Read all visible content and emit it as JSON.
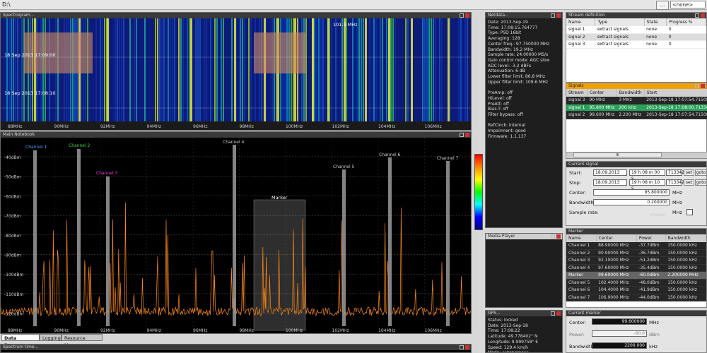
{
  "path": {
    "text": "D:\\",
    "dots": "...",
    "select": "<none>"
  },
  "spectrogram": {
    "title": "Spectrogram...",
    "time_labels": [
      "18 Sep 2013 17:09:00",
      "18 Sep 2013 17:08:10"
    ],
    "freq_badge": "101.9 MHz",
    "x_ticks": [
      "88MHz",
      "90MHz",
      "92MHz",
      "94MHz",
      "96MHz",
      "98MHz",
      "100MHz",
      "102MHz",
      "104MHz",
      "106MHz",
      "108"
    ]
  },
  "main": {
    "title": "Main Notebook",
    "y_ticks": [
      "-40dBm",
      "-50dBm",
      "-60dBm",
      "-70dBm",
      "-80dBm",
      "-90dBm",
      "-100dBm",
      "-110dBm",
      "-120dBm"
    ],
    "x_ticks": [
      "88MHz",
      "90MHz",
      "92MHz",
      "94MHz",
      "96MHz",
      "98MHz",
      "100MHz",
      "102MHz",
      "104MHz",
      "106MHz",
      "108"
    ],
    "marker_label": "Marker",
    "channels": [
      {
        "name": "Channel 1",
        "color": "#4aa0ff"
      },
      {
        "name": "Channel 2",
        "color": "#3fd14a"
      },
      {
        "name": "Channel 3",
        "color": "#e040e0"
      },
      {
        "name": "Channel 4",
        "color": "#cccccc"
      },
      {
        "name": "Channel 5",
        "color": "#cccccc"
      },
      {
        "name": "Channel 6",
        "color": "#cccccc"
      },
      {
        "name": "Channel 7",
        "color": "#cccccc"
      }
    ],
    "trace_color": "#ff8a1a"
  },
  "tabs": [
    "Data Processor",
    "Logging",
    "Resource Manager"
  ],
  "spectrum_time": {
    "title": "Spectrum time..."
  },
  "netdata": {
    "title": "Netdata...",
    "lines": [
      "Date: 2013-Sep-19",
      "Time: 17:08:15.764777",
      "Type: PSD 16bit",
      "Averaging: 128",
      "Center freq.: 97.750000 MHz",
      "Bandwidth: 19.2 MHz",
      "Sample rate: 24.00000 MS/s",
      "Gain control mode: AGC slow",
      "ADC level: -3.2 dBFs",
      "Attenuation: 6 dB",
      "Lower filter limit: 86.8 MHz",
      "Upper filter limit: 109.6 MHz",
      "",
      "PreAmp: off",
      "HiLevel: off",
      "PreAtt: off",
      "Bias-T: off",
      "Filter bypass: off",
      "",
      "RefClock: internal",
      "Impairment: good",
      "Firmware: 1.1.137"
    ]
  },
  "media_player": {
    "title": "Media Player"
  },
  "gps": {
    "title": "GPS...",
    "lines": [
      "Status: locked",
      "Date: 2013-Sep-18",
      "Time: 17:08:22",
      "Latitude: 49.778402° N",
      "Longitude: 9.999758° E",
      "Speed: 129.4 km/h",
      "Mode: autonomous"
    ]
  },
  "stream_definition": {
    "title": "Stream definition",
    "headers": [
      "Name",
      "Type",
      "State",
      "Progress %"
    ],
    "rows": [
      [
        "signal 1",
        "extract signals",
        "none",
        "0"
      ],
      [
        "signal 2",
        "extract signals",
        "none",
        "0"
      ],
      [
        "signal 3",
        "extract signals",
        "none",
        "0"
      ]
    ]
  },
  "signals": {
    "title": "Signals",
    "headers": [
      "Stream",
      "Center",
      "Bandwidth",
      "Start"
    ],
    "rows": [
      [
        "signal 3",
        "90 MHz",
        "3 MHz",
        "2013-Sep-18 17:07:54.715006"
      ],
      [
        "signal 1",
        "95.800 MHz",
        "200 kHz",
        "2013-Sep-18 17:08:00.713342"
      ],
      [
        "signal 2",
        "99.600 MHz",
        "2.200 MHz",
        "2013-Sep-18 17:07:54.715006"
      ]
    ],
    "selected_row": 1,
    "scroll_label": "III"
  },
  "current_signal": {
    "title": "Current signal",
    "start_label": "Start:",
    "start_date": "18.09.2013",
    "start_time": "19 h  08 m  00 s",
    "start_ms": "713342",
    "stop_label": "Stop:",
    "stop_date": "18.09.2013",
    "stop_time": "19 h  08 m  10 s",
    "stop_ms": "713342",
    "set_label": "set",
    "goto_label": "goto",
    "center_label": "Center:",
    "center_value": "95.800000",
    "center_unit": "MHz",
    "bandwidth_label": "Bandwidth:",
    "bandwidth_value": "0.200000",
    "bandwidth_unit": "MHz",
    "sample_rate_label": "Sample rate:",
    "sample_rate_value": "_._____",
    "sample_rate_unit": "MHz"
  },
  "marker": {
    "title": "Marker",
    "headers": [
      "Name",
      "Center",
      "Power",
      "Bandwidth"
    ],
    "rows": [
      [
        "Channel 1",
        "88.90000 MHz",
        "-37.7dBm",
        "150.0000 kHz"
      ],
      [
        "Channel 2",
        "90.90000 MHz",
        "-36.7dBm",
        "150.0000 kHz"
      ],
      [
        "Channel 3",
        "92.10000 MHz",
        "-51.2dBm",
        "150.0000 kHz"
      ],
      [
        "Channel 4",
        "97.60000 MHz",
        "-35.4dBm",
        "150.0000 kHz"
      ],
      [
        "Marker",
        "99.60000 MHz",
        "-60.0dBm",
        "2.200000 MHz"
      ],
      [
        "Channel 5",
        "102.4000 MHz",
        "-48.0dBm",
        "150.0000 kHz"
      ],
      [
        "Channel 6",
        "104.4000 MHz",
        "-41.9dBm",
        "150.0000 kHz"
      ],
      [
        "Channel 7",
        "106.9000 MHz",
        "-44.0dBm",
        "150.0000 kHz"
      ]
    ],
    "selected_row": 4
  },
  "current_marker": {
    "title": "Current marker",
    "center_label": "Center:",
    "center_value": "99.600000",
    "center_unit": "MHz",
    "power_label": "Power:",
    "power_value": "-60.0",
    "power_unit": "dBm",
    "bandwidth_label": "Bandwidth:",
    "bandwidth_value": "2200.000",
    "bandwidth_unit": "kHz"
  }
}
